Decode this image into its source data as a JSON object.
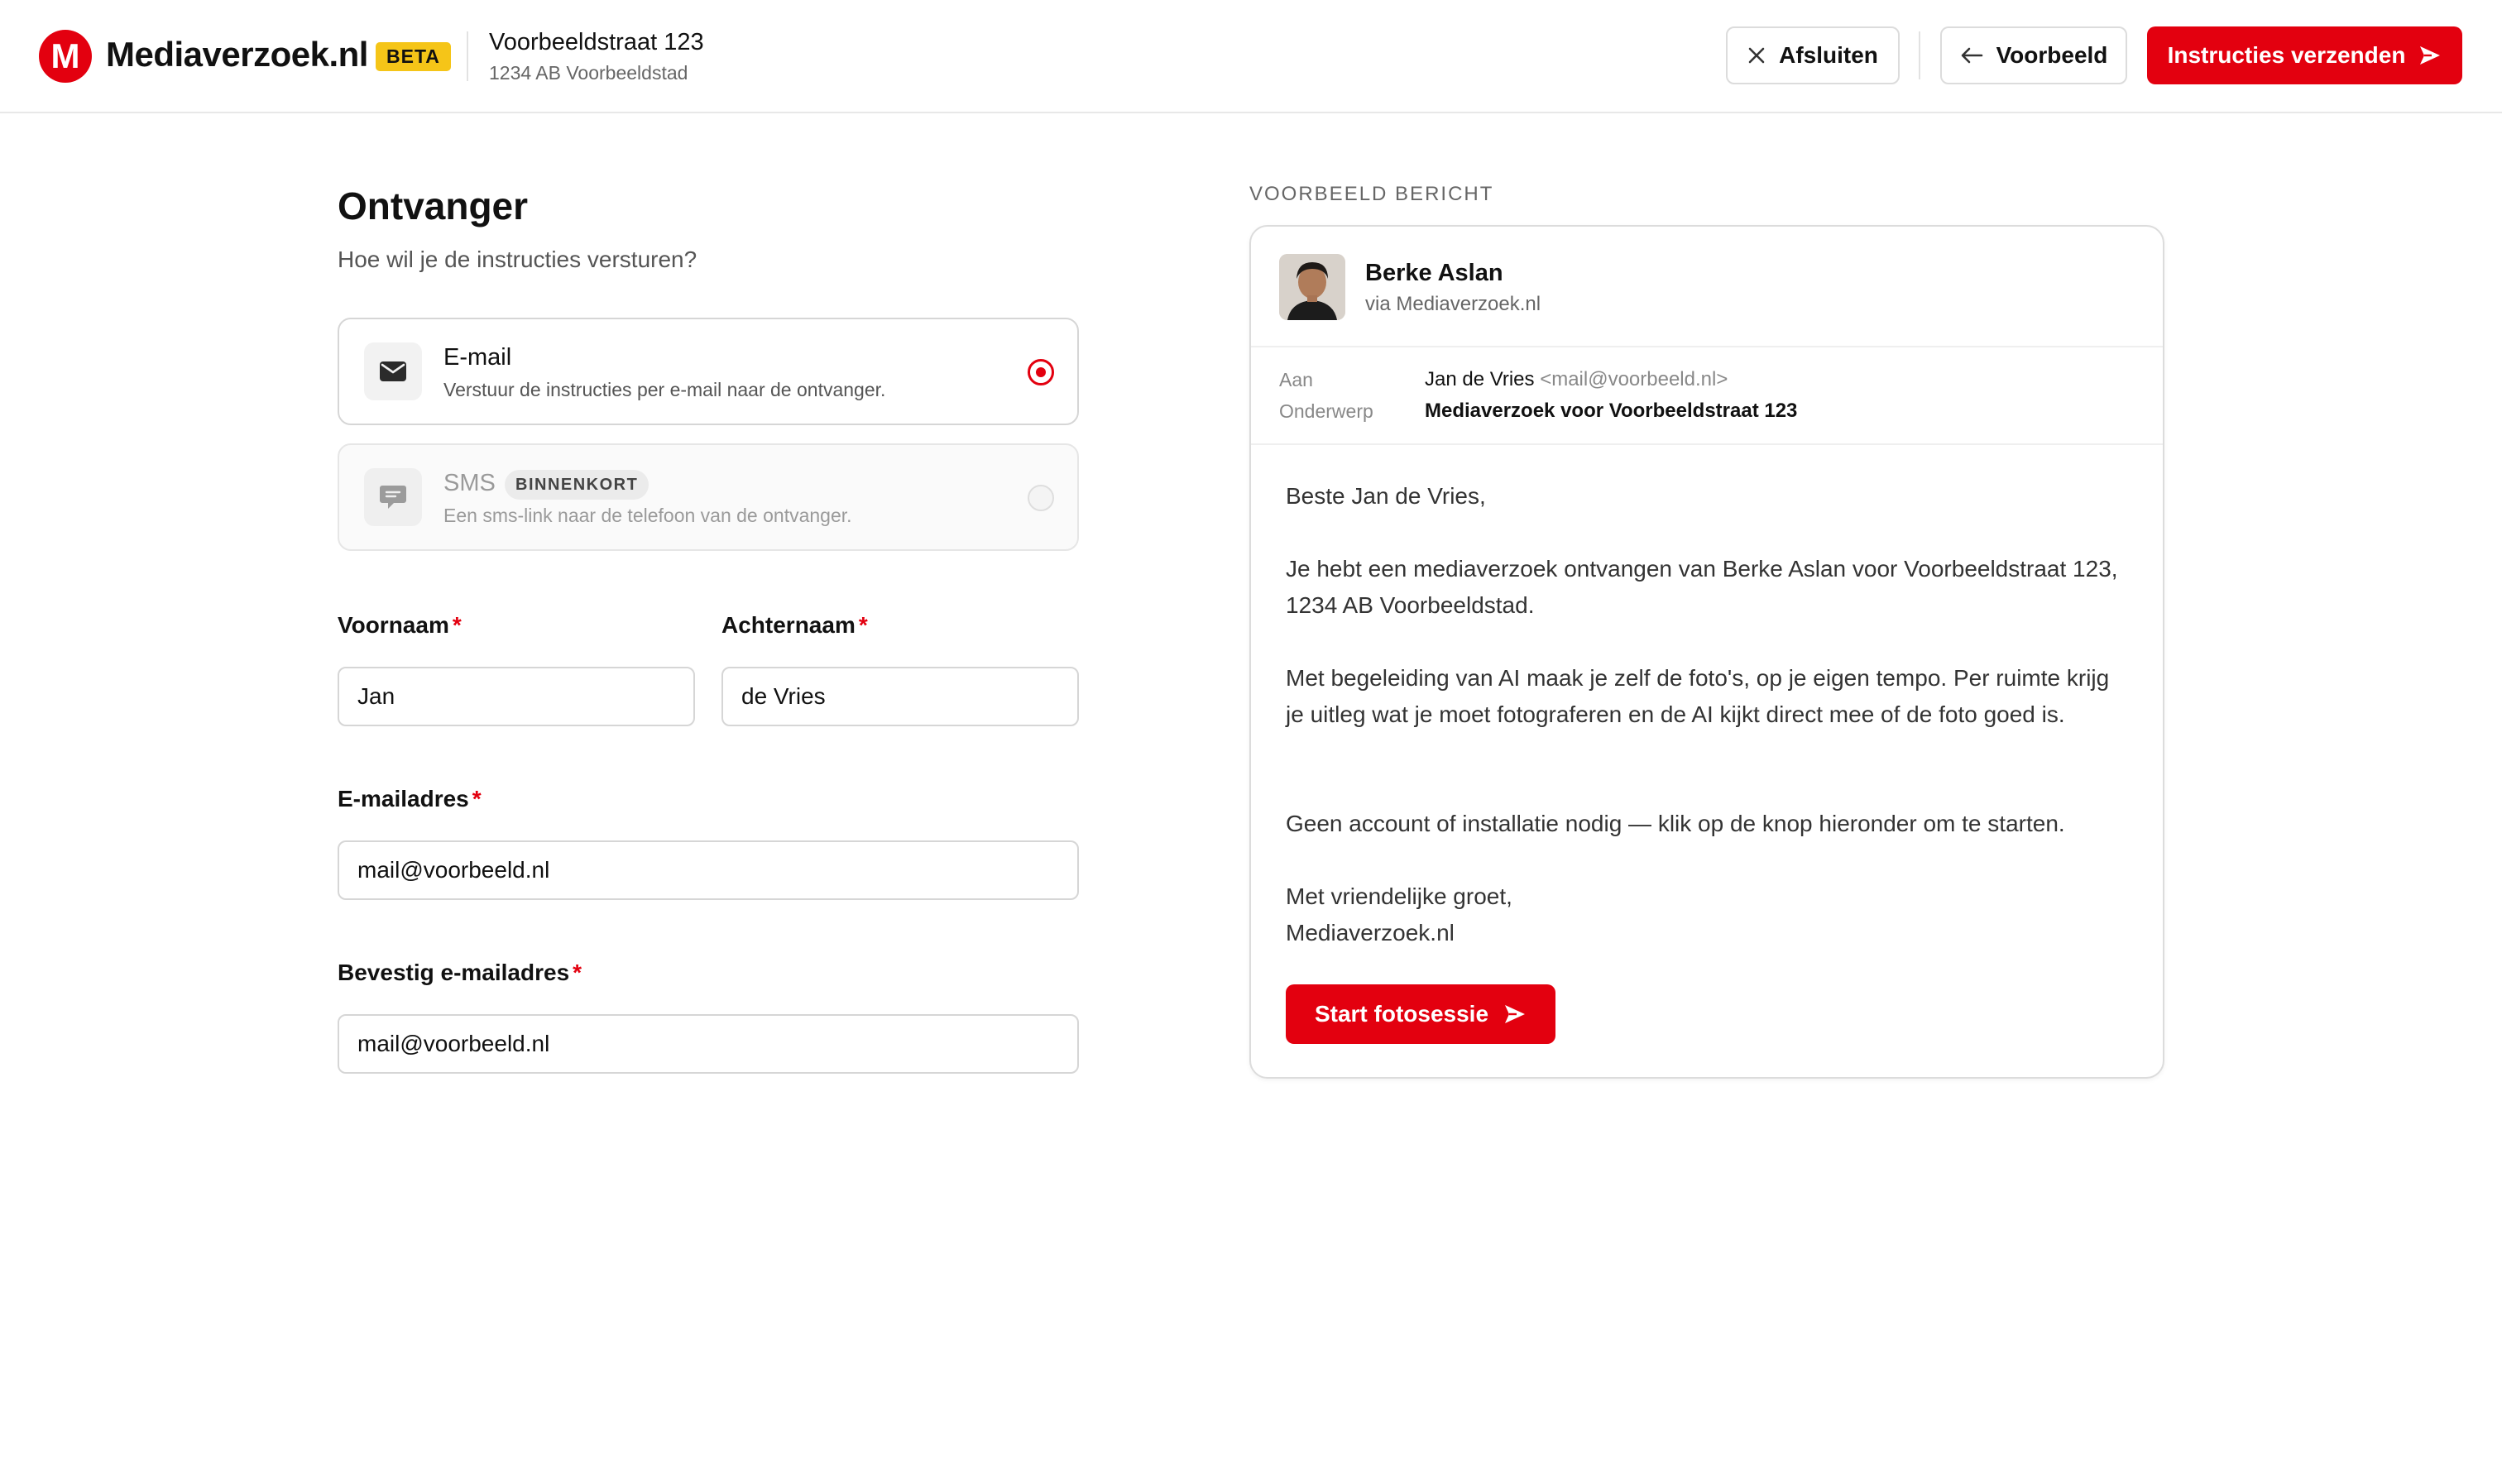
{
  "header": {
    "logo_letter": "M",
    "brand": "Mediaverzoek.nl",
    "badge": "BETA",
    "address_line1": "Voorbeeldstraat 123",
    "address_line2": "1234 AB Voorbeeldstad",
    "close_label": "Afsluiten",
    "preview_label": "Voorbeeld",
    "send_label": "Instructies verzenden"
  },
  "form": {
    "title": "Ontvanger",
    "subtitle": "Hoe wil je de instructies versturen?",
    "channels": [
      {
        "title": "E-mail",
        "description": "Verstuur de instructies per e-mail naar de ontvanger.",
        "selected": true
      },
      {
        "title": "SMS",
        "badge": "BINNENKORT",
        "description": "Een sms-link naar de telefoon van de ontvanger.",
        "selected": false
      }
    ],
    "required_mark": "*",
    "first_name": {
      "label": "Voornaam",
      "value": "Jan"
    },
    "last_name": {
      "label": "Achternaam",
      "value": "de Vries"
    },
    "email": {
      "label": "E-mailadres",
      "value": "mail@voorbeeld.nl"
    },
    "email_confirm": {
      "label": "Bevestig e-mailadres",
      "value": "mail@voorbeeld.nl"
    }
  },
  "preview": {
    "section_label": "VOORBEELD BERICHT",
    "sender_name": "Berke Aslan",
    "sender_via": "via Mediaverzoek.nl",
    "to_key": "Aan",
    "to_name": "Jan de Vries",
    "to_email": "<mail@voorbeeld.nl>",
    "subject_key": "Onderwerp",
    "subject": "Mediaverzoek voor Voorbeeldstraat 123",
    "greeting": "Beste Jan de Vries,",
    "paragraph1": "Je hebt een mediaverzoek ontvangen van Berke Aslan voor Voorbeeldstraat 123, 1234 AB Voorbeeldstad.",
    "paragraph2": "Met begeleiding van AI maak je zelf de foto's, op je eigen tempo. Per ruimte krijg je uitleg wat je moet fotograferen en de AI kijkt direct mee of de foto goed is.",
    "paragraph3": "Geen account of installatie nodig — klik op de knop hieronder om te starten.",
    "closing": "Met vriendelijke groet,",
    "signature": "Mediaverzoek.nl",
    "cta_label": "Start fotosessie"
  },
  "colors": {
    "accent": "#e3000f",
    "badge": "#f5c518"
  },
  "icons": [
    "close-icon",
    "arrow-left-icon",
    "send-icon",
    "mail-icon",
    "chat-icon"
  ]
}
